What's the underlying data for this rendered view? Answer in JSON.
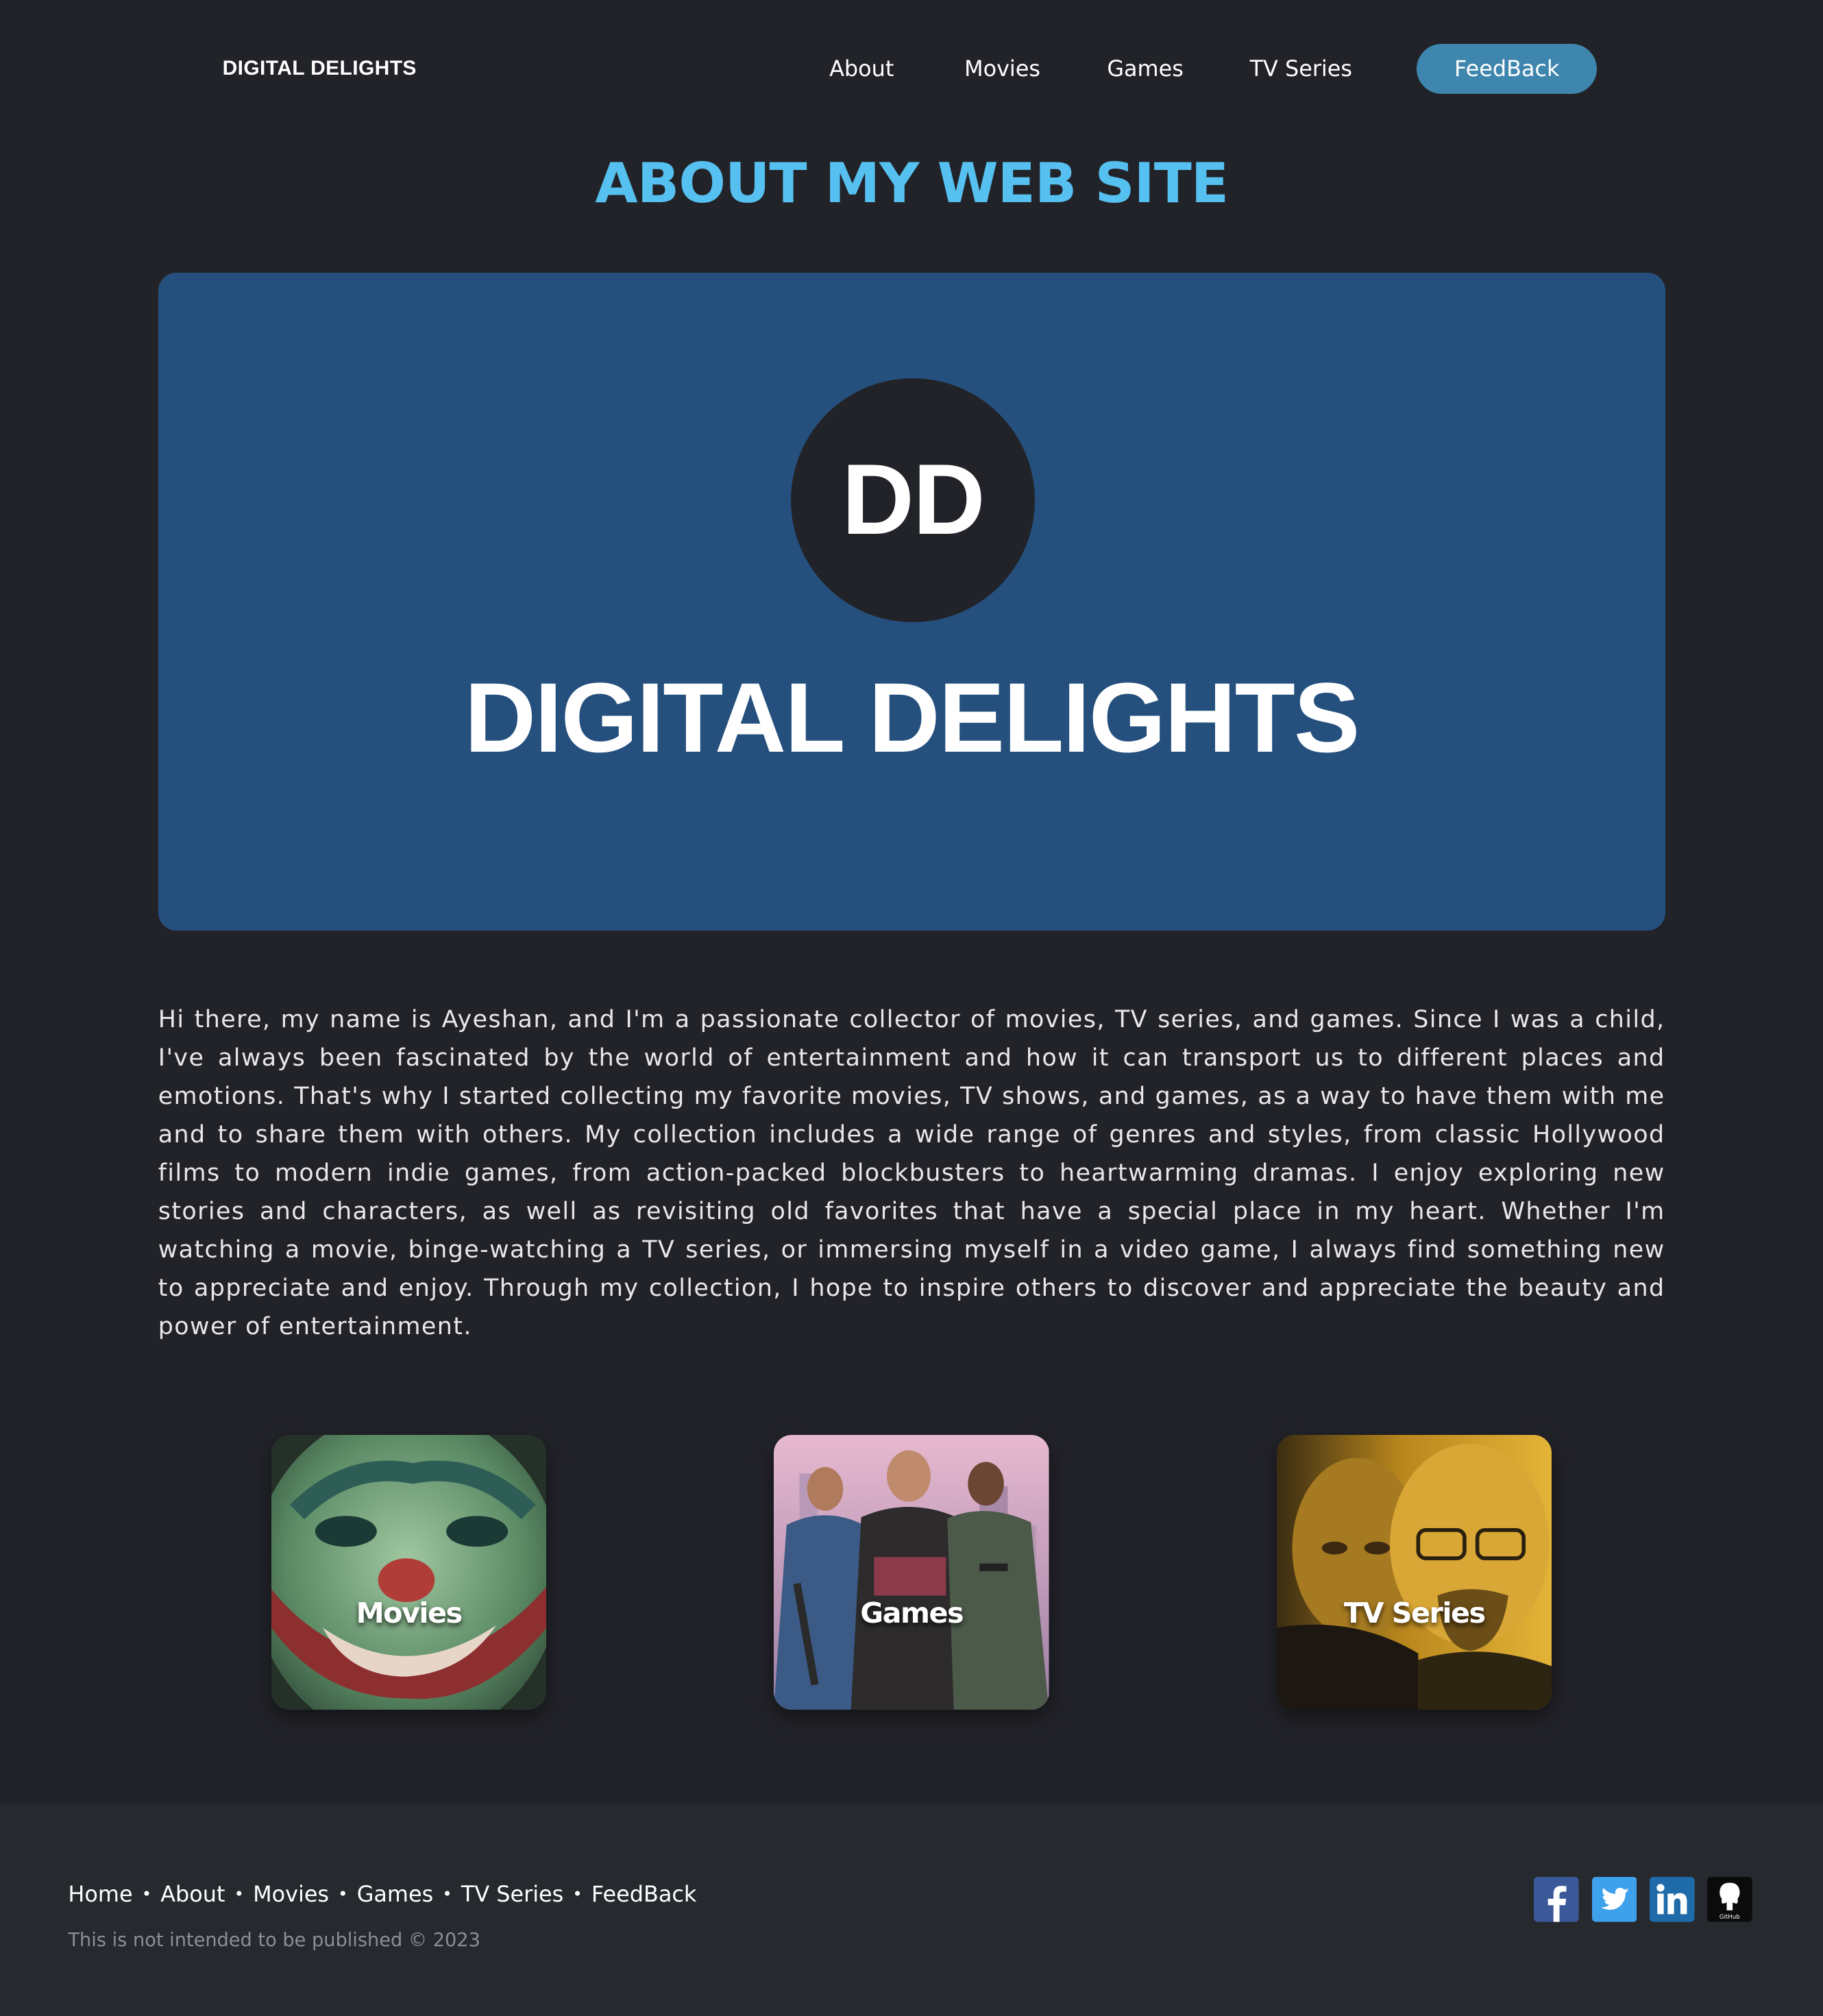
{
  "header": {
    "brand": "DIGITAL DELIGHTS",
    "nav": [
      "About",
      "Movies",
      "Games",
      "TV Series"
    ],
    "feedback_label": "FeedBack"
  },
  "main": {
    "title": "ABOUT MY WEB SITE",
    "hero": {
      "logo_initials": "DD",
      "site_name": "DIGITAL DELIGHTS"
    },
    "about_paragraph": "Hi there, my name is Ayeshan, and I'm a passionate collector of movies, TV series, and games. Since I was a child, I've always been fascinated by the world of entertainment and how it can transport us to different places and emotions. That's why I started collecting my favorite movies, TV shows, and games, as a way to have them with me and to share them with others. My collection includes a wide range of genres and styles, from classic Hollywood films to modern indie games, from action-packed blockbusters to heartwarming dramas. I enjoy exploring new stories and characters, as well as revisiting old favorites that have a special place in my heart. Whether I'm watching a movie, binge-watching a TV series, or immersing myself in a video game, I always find something new to appreciate and enjoy. Through my collection, I hope to inspire others to discover and appreciate the beauty and power of entertainment.",
    "categories": [
      {
        "label": "Movies",
        "image": "joker-face-image"
      },
      {
        "label": "Games",
        "image": "gta-characters-image"
      },
      {
        "label": "TV Series",
        "image": "breaking-bad-image"
      }
    ]
  },
  "footer": {
    "links": [
      "Home",
      "About",
      "Movies",
      "Games",
      "TV Series",
      "FeedBack"
    ],
    "copyright": "This is not intended to be published © 2023",
    "social_icons": [
      "facebook-icon",
      "twitter-icon",
      "linkedin-icon",
      "github-icon"
    ],
    "github_caption": "GitHub"
  },
  "colors": {
    "background": "#222329",
    "accent_title": "#56c0f0",
    "hero_panel": "#25507e",
    "feedback_button": "#3e86ad",
    "footer_background": "#26292e"
  }
}
